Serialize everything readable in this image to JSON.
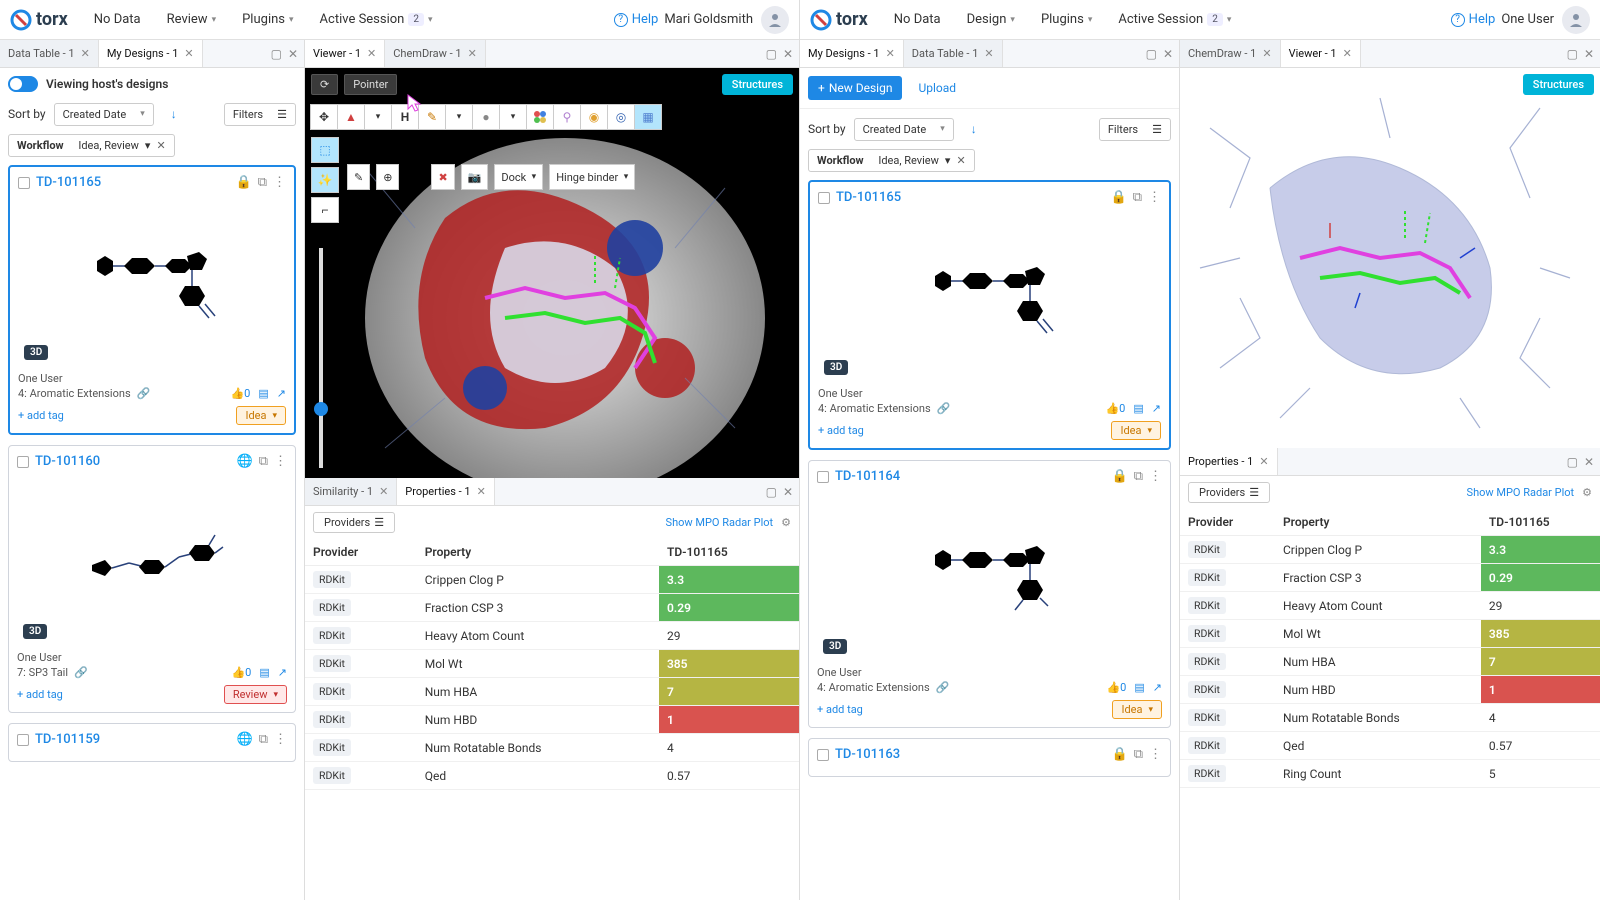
{
  "brand": "torx",
  "left": {
    "nav": [
      "No Data",
      "Review",
      "Plugins",
      "Active Session"
    ],
    "session_badge": "2",
    "help": "Help",
    "user": "Mari Goldsmith",
    "tabs": {
      "data_table": "Data Table - 1",
      "my_designs": "My Designs - 1"
    },
    "toggle_label": "Viewing host's designs",
    "sort_label": "Sort by",
    "sort_value": "Created Date",
    "filters_label": "Filters",
    "wf_label": "Workflow",
    "wf_value": "Idea, Review",
    "cards": [
      {
        "id": "TD-101165",
        "user": "One User",
        "series": "4: Aromatic Extensions",
        "status": "Idea",
        "selected": true,
        "d3": true,
        "locked": true,
        "likes": "0"
      },
      {
        "id": "TD-101160",
        "user": "One User",
        "series": "7: SP3 Tail",
        "status": "Review",
        "selected": false,
        "d3": true,
        "globe": true,
        "likes": "0"
      },
      {
        "id": "TD-101159",
        "globe": true
      }
    ],
    "add_tag": "+ add tag",
    "viewer_tabs": {
      "viewer": "Viewer - 1",
      "chemdraw": "ChemDraw - 1"
    },
    "bottom_tabs": {
      "sim": "Similarity - 1",
      "props": "Properties - 1"
    },
    "pointer_label": "Pointer",
    "dock_label": "Dock",
    "hinge_label": "Hinge binder",
    "structures_btn": "Structures",
    "providers_btn": "Providers",
    "radar_link": "Show MPO Radar Plot",
    "ptable": {
      "cols": [
        "Provider",
        "Property",
        "TD-101165"
      ],
      "rows": [
        {
          "prov": "RDKit",
          "prop": "Crippen Clog P",
          "val": "3.3",
          "cls": "val-green"
        },
        {
          "prov": "RDKit",
          "prop": "Fraction CSP 3",
          "val": "0.29",
          "cls": "val-green"
        },
        {
          "prov": "RDKit",
          "prop": "Heavy Atom Count",
          "val": "29",
          "cls": "val-plain"
        },
        {
          "prov": "RDKit",
          "prop": "Mol Wt",
          "val": "385",
          "cls": "val-olive"
        },
        {
          "prov": "RDKit",
          "prop": "Num HBA",
          "val": "7",
          "cls": "val-olive"
        },
        {
          "prov": "RDKit",
          "prop": "Num HBD",
          "val": "1",
          "cls": "val-red"
        },
        {
          "prov": "RDKit",
          "prop": "Num Rotatable Bonds",
          "val": "4",
          "cls": "val-plain"
        },
        {
          "prov": "RDKit",
          "prop": "Qed",
          "val": "0.57",
          "cls": "val-plain"
        }
      ]
    }
  },
  "right": {
    "nav": [
      "No Data",
      "Design",
      "Plugins",
      "Active Session"
    ],
    "session_badge": "2",
    "help": "Help",
    "user": "One User",
    "tabs": {
      "my_designs": "My Designs - 1",
      "data_table": "Data Table - 1"
    },
    "new_design": "New Design",
    "upload": "Upload",
    "sort_label": "Sort by",
    "sort_value": "Created Date",
    "filters_label": "Filters",
    "wf_label": "Workflow",
    "wf_value": "Idea, Review",
    "cards": [
      {
        "id": "TD-101165",
        "user": "One User",
        "series": "4: Aromatic Extensions",
        "status": "Idea",
        "selected": true,
        "d3": true,
        "locked": true,
        "likes": "0"
      },
      {
        "id": "TD-101164",
        "user": "One User",
        "series": "4: Aromatic Extensions",
        "status": "Idea",
        "selected": false,
        "d3": true,
        "locked": true,
        "likes": "0"
      },
      {
        "id": "TD-101163",
        "locked": true
      }
    ],
    "add_tag": "+ add tag",
    "viewer_tabs": {
      "chemdraw": "ChemDraw - 1",
      "viewer": "Viewer - 1"
    },
    "prop_tab": "Properties - 1",
    "structures_btn": "Structures",
    "providers_btn": "Providers",
    "radar_link": "Show MPO Radar Plot",
    "ptable": {
      "cols": [
        "Provider",
        "Property",
        "TD-101165"
      ],
      "rows": [
        {
          "prov": "RDKit",
          "prop": "Crippen Clog P",
          "val": "3.3",
          "cls": "val-green"
        },
        {
          "prov": "RDKit",
          "prop": "Fraction CSP 3",
          "val": "0.29",
          "cls": "val-green"
        },
        {
          "prov": "RDKit",
          "prop": "Heavy Atom Count",
          "val": "29",
          "cls": "val-plain"
        },
        {
          "prov": "RDKit",
          "prop": "Mol Wt",
          "val": "385",
          "cls": "val-olive"
        },
        {
          "prov": "RDKit",
          "prop": "Num HBA",
          "val": "7",
          "cls": "val-olive"
        },
        {
          "prov": "RDKit",
          "prop": "Num HBD",
          "val": "1",
          "cls": "val-red"
        },
        {
          "prov": "RDKit",
          "prop": "Num Rotatable Bonds",
          "val": "4",
          "cls": "val-plain"
        },
        {
          "prov": "RDKit",
          "prop": "Qed",
          "val": "0.57",
          "cls": "val-plain"
        },
        {
          "prov": "RDKit",
          "prop": "Ring Count",
          "val": "5",
          "cls": "val-plain"
        }
      ]
    }
  },
  "badge_3d": "3D"
}
